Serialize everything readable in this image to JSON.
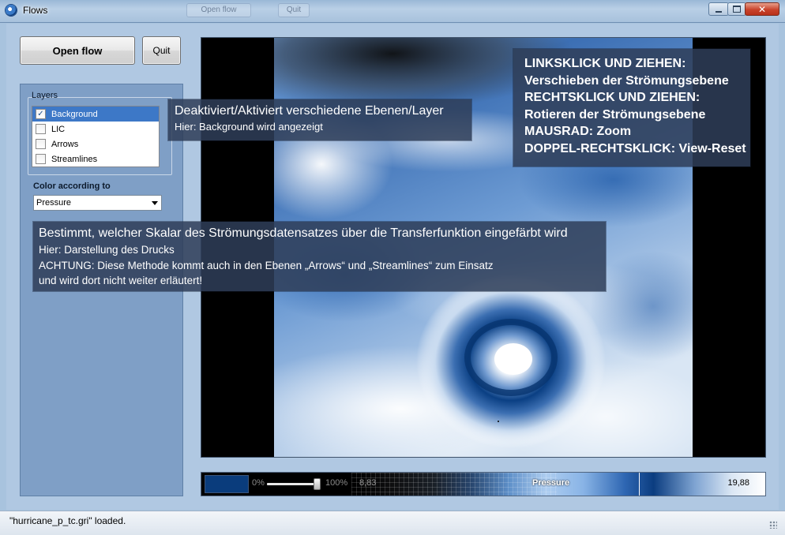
{
  "window": {
    "title": "Flows",
    "ghost_tabs": [
      "Open flow",
      "Quit"
    ]
  },
  "toolbar": {
    "open_flow_label": "Open flow",
    "quit_label": "Quit"
  },
  "layers": {
    "title": "Layers",
    "items": [
      {
        "label": "Background",
        "checked": true,
        "selected": true
      },
      {
        "label": "LIC",
        "checked": false,
        "selected": false
      },
      {
        "label": "Arrows",
        "checked": false,
        "selected": false
      },
      {
        "label": "Streamlines",
        "checked": false,
        "selected": false
      }
    ]
  },
  "color_mapping": {
    "label": "Color according to",
    "selected": "Pressure"
  },
  "transfer_function": {
    "min_pct": "0%",
    "max_pct": "100%",
    "opacity_fraction": 1.0,
    "min_value": "8,83",
    "label": "Pressure",
    "max_value": "19,88"
  },
  "status": {
    "text": "\"hurricane_p_tc.gri\" loaded."
  },
  "tooltips": {
    "layers_tip": {
      "heading": "Deaktiviert/Aktiviert verschiedene Ebenen/Layer",
      "detail": "Hier: Background wird angezeigt"
    },
    "controls_tip": {
      "lines": [
        "LINKSKLICK UND ZIEHEN:",
        "Verschieben der Strömungsebene",
        "RECHTSKLICK UND ZIEHEN:",
        "Rotieren der Strömungsebene",
        "MAUSRAD: Zoom",
        "DOPPEL-RECHTSKLICK: View-Reset"
      ]
    },
    "color_tip": {
      "heading": "Bestimmt, welcher Skalar des Strömungsdatensatzes über die Transferfunktion eingefärbt wird",
      "lines": [
        "Hier: Darstellung des Drucks",
        "ACHTUNG: Diese Methode kommt auch in den Ebenen „Arrows“ und „Streamlines“ zum Einsatz",
        "und wird dort nicht weiter erläutert!"
      ]
    }
  },
  "icons": {
    "app": "flows-app-icon",
    "minimize": "minimize-icon",
    "maximize": "maximize-icon",
    "close": "close-icon",
    "dropdown": "chevron-down-icon",
    "checkbox_checked": "check-icon",
    "resize": "resize-grip-icon"
  },
  "colors": {
    "accent": "#3d78c7",
    "panel": "#7f9fc6",
    "tooltip": "#2e3e58",
    "flow_dark": "#0b3d80"
  }
}
